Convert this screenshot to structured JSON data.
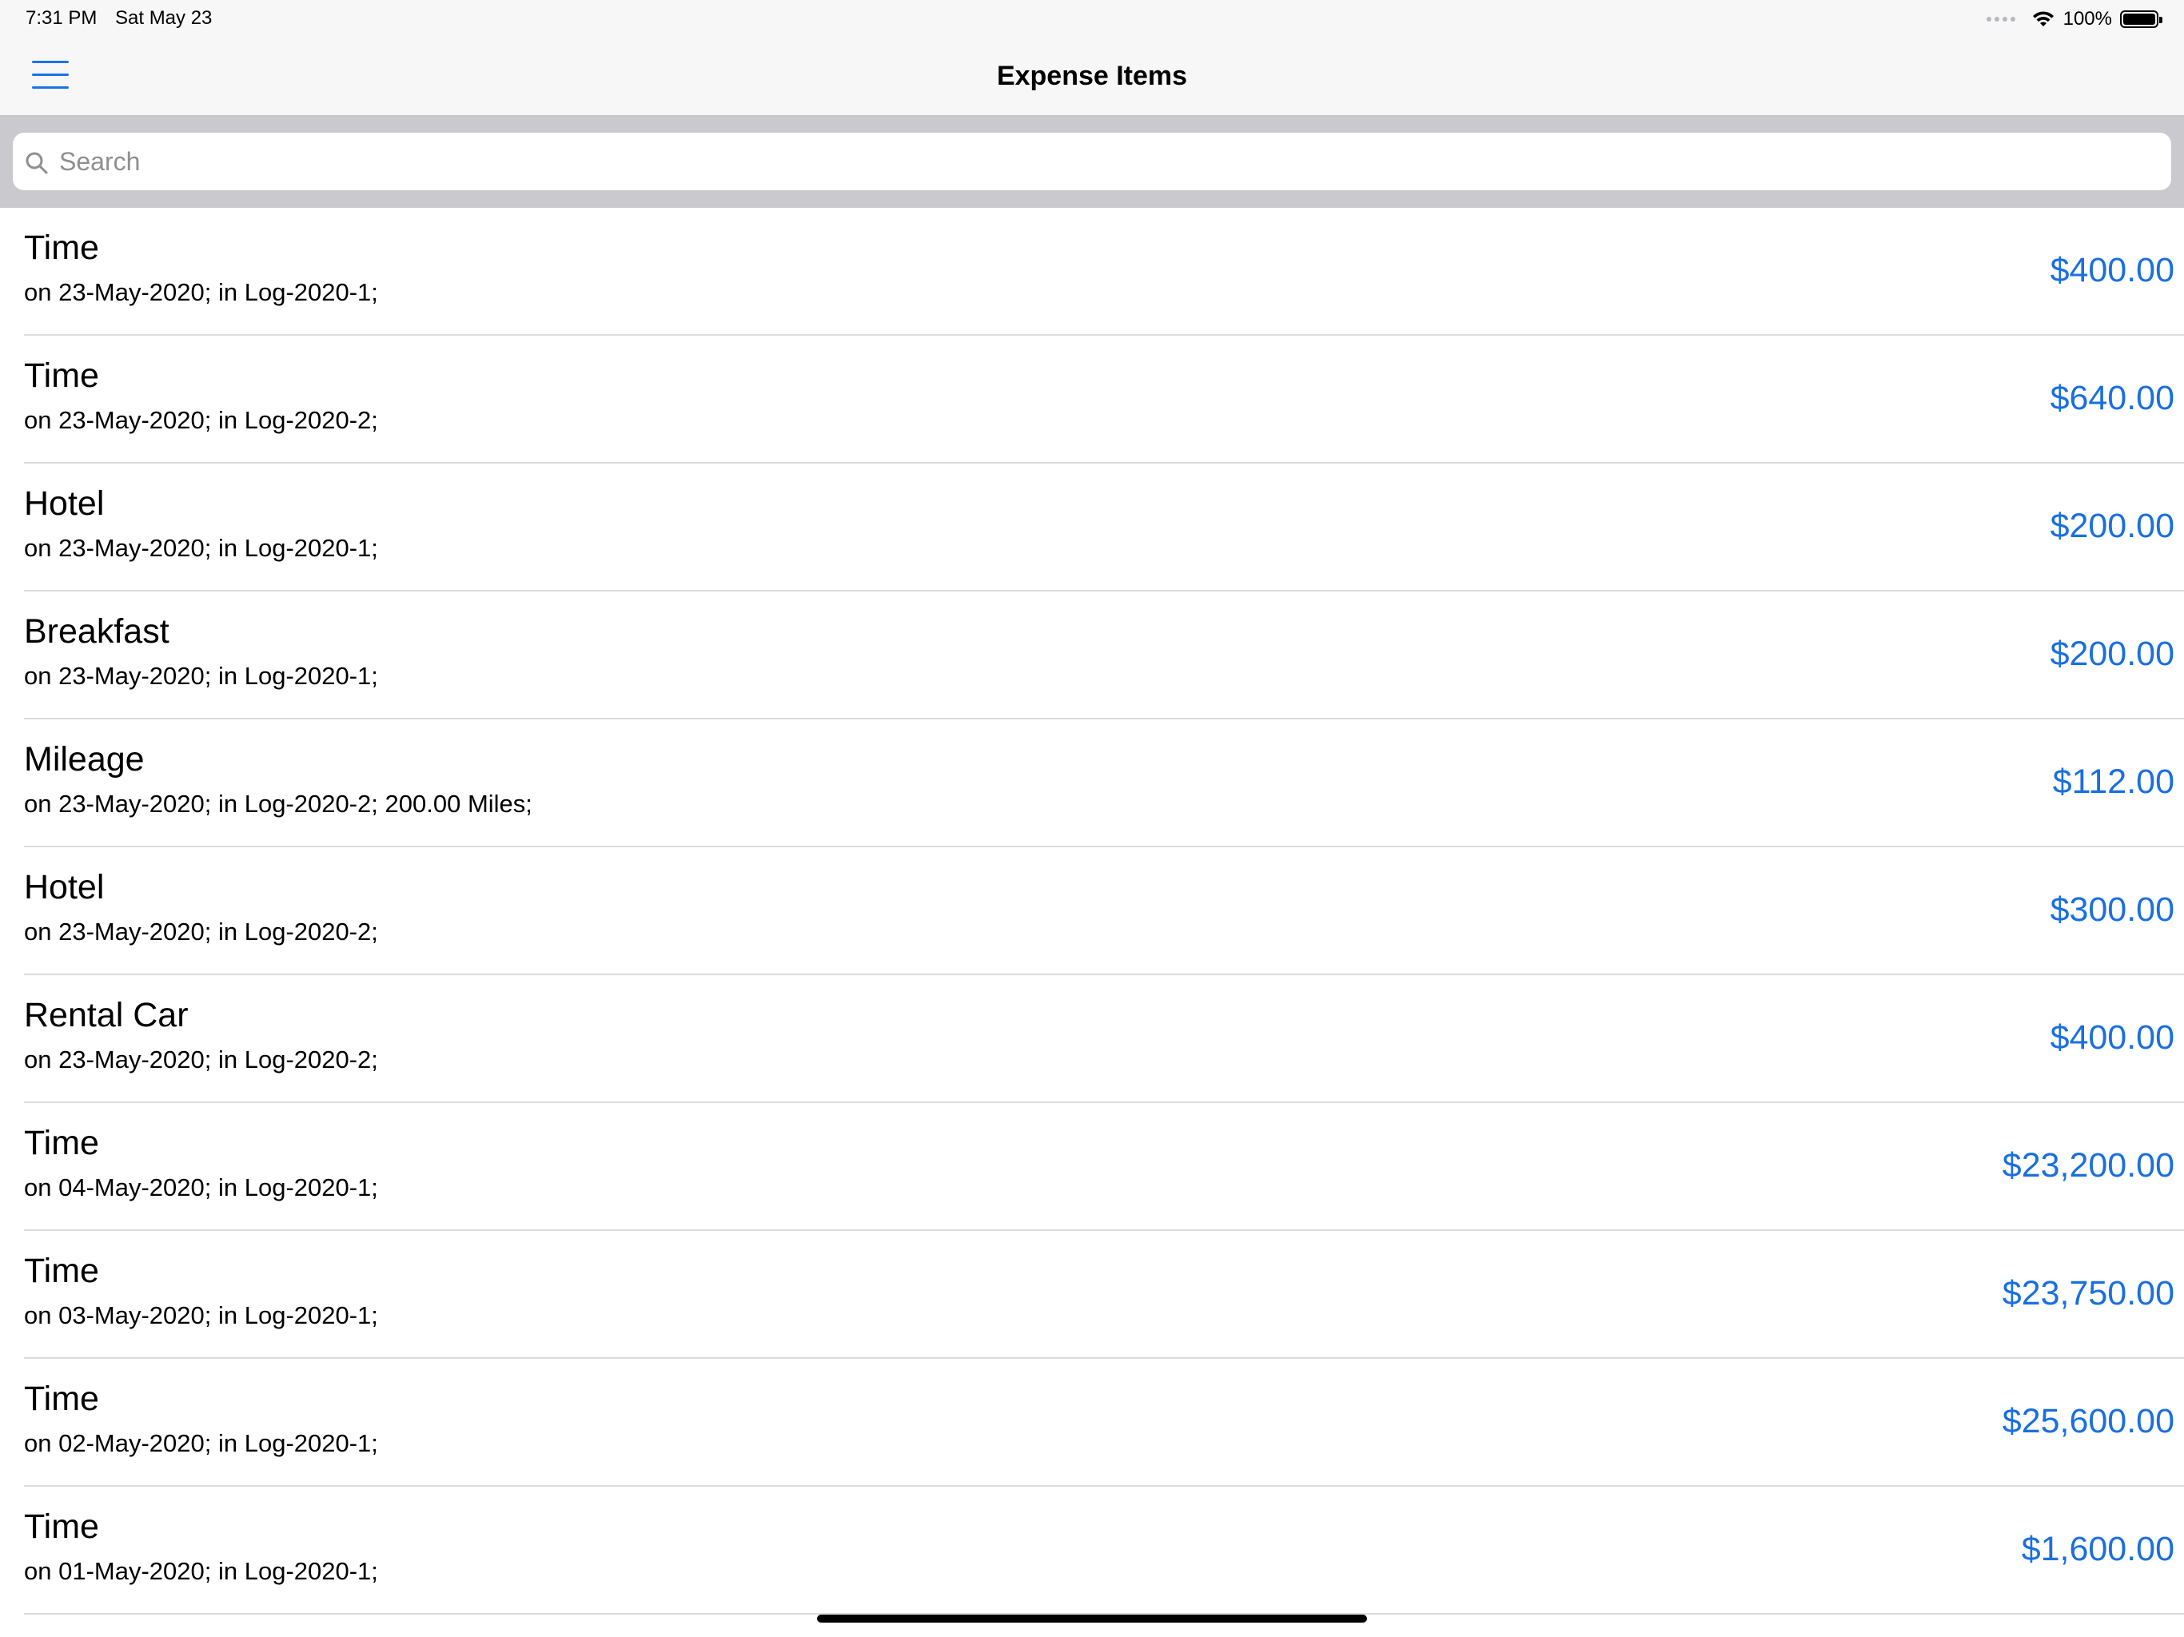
{
  "status_bar": {
    "time": "7:31 PM",
    "date": "Sat May 23",
    "battery_percent": "100%",
    "battery_level": 1.0
  },
  "nav": {
    "title": "Expense Items",
    "menu_icon": "hamburger-menu-icon"
  },
  "search": {
    "placeholder": "Search",
    "value": "",
    "icon": "search-icon"
  },
  "accent_color": "#1a6fe0",
  "items": [
    {
      "title": "Time",
      "subtitle": "on 23-May-2020; in Log-2020-1;",
      "amount": "$400.00"
    },
    {
      "title": "Time",
      "subtitle": "on 23-May-2020; in Log-2020-2;",
      "amount": "$640.00"
    },
    {
      "title": "Hotel",
      "subtitle": "on 23-May-2020; in Log-2020-1;",
      "amount": "$200.00"
    },
    {
      "title": "Breakfast",
      "subtitle": "on 23-May-2020; in Log-2020-1;",
      "amount": "$200.00"
    },
    {
      "title": "Mileage",
      "subtitle": "on 23-May-2020; in Log-2020-2; 200.00 Miles;",
      "amount": "$112.00"
    },
    {
      "title": "Hotel",
      "subtitle": "on 23-May-2020; in Log-2020-2;",
      "amount": "$300.00"
    },
    {
      "title": "Rental Car",
      "subtitle": "on 23-May-2020; in Log-2020-2;",
      "amount": "$400.00"
    },
    {
      "title": "Time",
      "subtitle": "on 04-May-2020; in Log-2020-1;",
      "amount": "$23,200.00"
    },
    {
      "title": "Time",
      "subtitle": "on 03-May-2020; in Log-2020-1;",
      "amount": "$23,750.00"
    },
    {
      "title": "Time",
      "subtitle": "on 02-May-2020; in Log-2020-1;",
      "amount": "$25,600.00"
    },
    {
      "title": "Time",
      "subtitle": "on 01-May-2020; in Log-2020-1;",
      "amount": "$1,600.00"
    }
  ]
}
